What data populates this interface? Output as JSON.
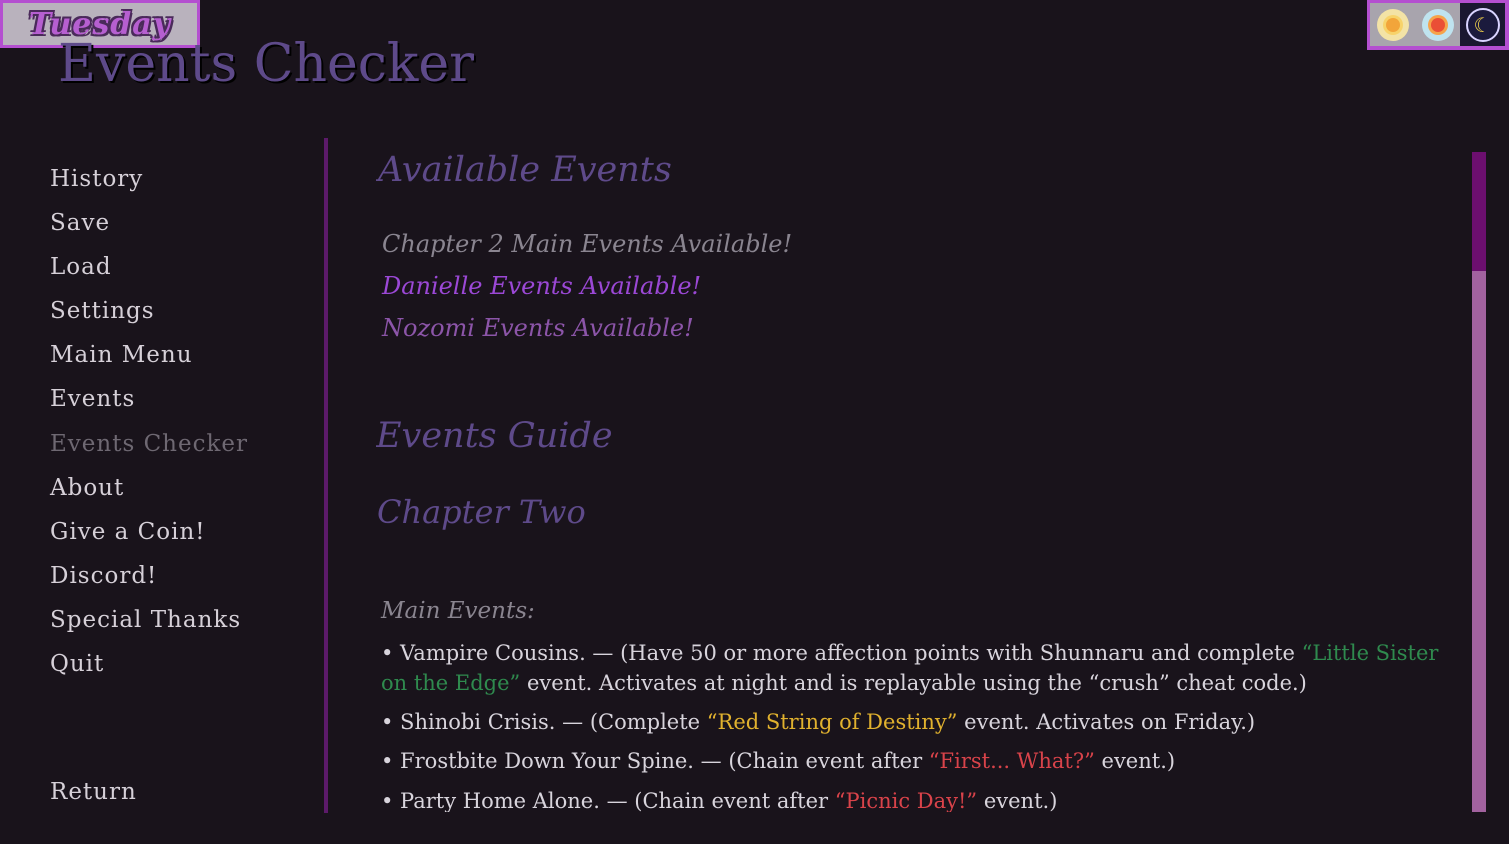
{
  "hud": {
    "day": "Tuesday",
    "time_slots": [
      {
        "icon": "morning-sun-icon",
        "active": false
      },
      {
        "icon": "noon-sun-icon",
        "active": false
      },
      {
        "icon": "night-moon-icon",
        "active": true
      }
    ]
  },
  "screen": {
    "title": "Events Checker"
  },
  "sidebar": {
    "items": [
      {
        "label": "History"
      },
      {
        "label": "Save"
      },
      {
        "label": "Load"
      },
      {
        "label": "Settings"
      },
      {
        "label": "Main Menu"
      },
      {
        "label": "Events"
      },
      {
        "label": "Events Checker",
        "current": true
      },
      {
        "label": "About"
      },
      {
        "label": "Give a Coin!"
      },
      {
        "label": "Discord!"
      },
      {
        "label": "Special Thanks"
      },
      {
        "label": "Quit"
      }
    ],
    "return_label": "Return"
  },
  "available": {
    "heading": "Available Events",
    "items": [
      {
        "text": "Chapter 2 Main Events Available!",
        "color": "#8a8590"
      },
      {
        "text": "Danielle Events Available!",
        "color": "#9b48d6"
      },
      {
        "text": "Nozomi Events Available!",
        "color": "#8c55a9"
      }
    ]
  },
  "guide": {
    "heading": "Events Guide",
    "chapter": "Chapter Two",
    "main_label": "Main Events:",
    "events": [
      {
        "name": "• Vampire Cousins.",
        "pre": " — (Have 50 or more affection points with Shunnaru and complete ",
        "highlight": "“Little Sister on the Edge”",
        "highlight_color": "green",
        "post": " event. Activates at night and is replayable using the “crush” cheat code.)"
      },
      {
        "name": "• Shinobi Crisis.",
        "pre": " — (Complete ",
        "highlight": "“Red String of Destiny”",
        "highlight_color": "yellow",
        "post": " event. Activates on Friday.)"
      },
      {
        "name": "• Frostbite Down Your Spine.",
        "pre": " — (Chain event after ",
        "highlight": "“First... What?”",
        "highlight_color": "red",
        "post": " event.)"
      },
      {
        "name": "• Party Home Alone.",
        "pre": " — (Chain event after ",
        "highlight": "“Picnic Day!”",
        "highlight_color": "red",
        "post": " event.)"
      }
    ]
  },
  "scrollbar": {
    "position": 0.0,
    "visible_fraction": 0.18
  }
}
